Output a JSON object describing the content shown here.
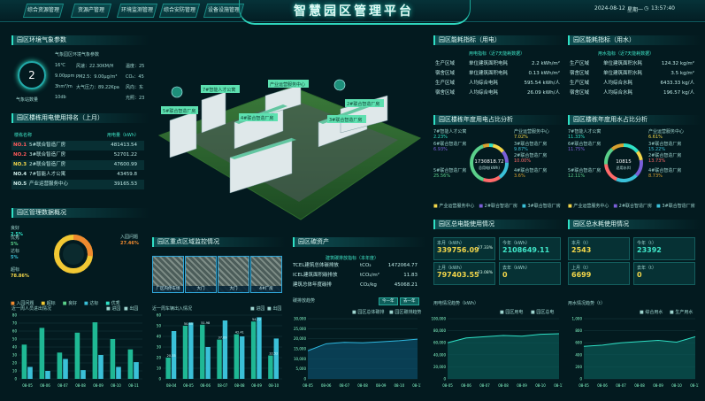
{
  "header": {
    "title": "智慧园区管理平台",
    "nav_left": [
      "综合资源管理",
      "资源产管理",
      "环境监测管理"
    ],
    "nav_right": [
      "综合安防管理",
      "设备设施管理"
    ],
    "date": "2024-08-12",
    "weekday": "星期一",
    "time": "13:57:40"
  },
  "env": {
    "title": "园区环境气象参数",
    "score": "2",
    "score_label": "气象站数量",
    "subtitle": "气象园区环境气象参数",
    "row1": [
      "16℃",
      "风速：22.30KM/H",
      "温度：25"
    ],
    "row2": [
      "9.00ppm",
      "PM2.5：9.00μg/m³",
      "CO₂：45"
    ],
    "row3": [
      "3hm³/m",
      "大气压力：89.22Kpa",
      "风向：东"
    ],
    "row4": [
      "10db",
      "",
      "光照：23"
    ]
  },
  "ranking": {
    "title": "园区楼栋用电使用排名（上月）",
    "col_name": "楼栋名称",
    "col_value": "用电量（kWh）",
    "rows": [
      {
        "no": "NO.1",
        "name": "5#联合智造厂房",
        "value": "481413.54"
      },
      {
        "no": "NO.2",
        "name": "3#联合智造厂房",
        "value": "52701.22"
      },
      {
        "no": "NO.3",
        "name": "2#联合智造厂房",
        "value": "47600.99"
      },
      {
        "no": "NO.4",
        "name": "7#智能人才公寓",
        "value": "43459.8"
      },
      {
        "no": "NO.5",
        "name": "产业运营服务中心",
        "value": "39165.53"
      }
    ]
  },
  "mgmt": {
    "title": "园区管理数据概况",
    "labels": [
      {
        "name": "良好",
        "pct": "2.5%"
      },
      {
        "name": "优秀",
        "pct": "5%"
      },
      {
        "name": "达标",
        "pct": "5%"
      },
      {
        "name": "超标",
        "pct": "78.86%"
      },
      {
        "name": "入园问题",
        "pct": "27.46%"
      }
    ],
    "legend": [
      "入园问题",
      "超标",
      "良好",
      "达标",
      "优秀"
    ],
    "chart_title": "近一周人员进出情况",
    "legend2": [
      "进园",
      "出园"
    ]
  },
  "people_chart": {
    "type": "bar",
    "categories": [
      "08-05",
      "08-06",
      "08-07",
      "08-08",
      "08-09",
      "08-10",
      "08-11"
    ],
    "series": [
      {
        "name": "进园",
        "values": [
          43,
          64,
          33,
          58,
          71,
          50,
          37
        ]
      },
      {
        "name": "出园",
        "values": [
          15,
          10,
          25,
          11,
          30,
          15,
          21
        ]
      }
    ],
    "ylim": [
      0,
      80
    ],
    "yticks": [
      "0",
      "10",
      "20",
      "30",
      "40",
      "50",
      "60",
      "70",
      "80"
    ]
  },
  "monitor": {
    "title": "园区重点区域监控情况",
    "cams": [
      "厂区内停车场",
      "大门",
      "大门",
      "4#厂房"
    ],
    "chart_title": "近一周车辆出入情况",
    "legend": [
      "进园",
      "出园"
    ]
  },
  "car_chart": {
    "type": "bar",
    "categories": [
      "08-04",
      "08-05",
      "08-06",
      "08-07",
      "08-08",
      "08-09",
      "08-10"
    ],
    "series": [
      {
        "name": "进园",
        "values": [
          20,
          50,
          51,
          37,
          42,
          54,
          22
        ]
      },
      {
        "name": "出园",
        "values": [
          45,
          53,
          30,
          55,
          40,
          58,
          38
        ]
      }
    ],
    "ylim": [
      0,
      60
    ],
    "yticks": [
      "0",
      "10",
      "20",
      "30",
      "40",
      "50",
      "60"
    ],
    "labels": [
      "20.33",
      "50.65",
      "51.98",
      "37.09",
      "42.41",
      "54.72",
      "22.52"
    ]
  },
  "carbon": {
    "title": "园区碳资产",
    "year_label": "建筑碳排放指标（本年度）",
    "rows": [
      {
        "name": "TCEL建筑总体碳排放",
        "unit": "tCO₂",
        "value": "1472064.77"
      },
      {
        "name": "ICEL建筑面积碳排放",
        "unit": "tCO₂/m²",
        "value": "11.83"
      },
      {
        "name": "建筑总体年度碳排",
        "unit": "CO₂/kg",
        "value": "45068.21"
      }
    ],
    "chart_title": "碳排放趋势",
    "tabs": [
      "今一年",
      "去一年"
    ],
    "legend": [
      "园区总体碳排",
      "园区碳排趋势"
    ]
  },
  "carbon_chart": {
    "type": "area",
    "ylim": [
      0,
      30000
    ],
    "yticks": [
      "0",
      "5,000",
      "10,000",
      "15,000",
      "20,000",
      "25,000",
      "30,000"
    ],
    "categories": [
      "08-05",
      "08-06",
      "08-07",
      "08-08",
      "08-09",
      "08-10",
      "08-11"
    ],
    "values": [
      14000,
      17500,
      18200,
      18000,
      18500,
      19000,
      19800
    ]
  },
  "elec": {
    "title": "园区能耗指标（用电）",
    "sub": "用电指标（近7天能耗数据）",
    "rows": [
      {
        "a": "生产区域",
        "b": "单位建筑面积电耗",
        "v": "2.2 kWh/m²"
      },
      {
        "a": "宿舍区域",
        "b": "单位建筑面积电耗",
        "v": "0.13 kWh/m²"
      },
      {
        "a": "生产区域",
        "b": "人均综合电耗",
        "v": "595.54 kWh/人"
      },
      {
        "a": "宿舍区域",
        "b": "人均综合电耗",
        "v": "26.09 kWh/人"
      }
    ]
  },
  "water": {
    "title": "园区能耗指标（用水）",
    "sub": "用水指标（近7天能耗数据）",
    "rows": [
      {
        "a": "生产区域",
        "b": "单位建筑面积水耗",
        "v": "124.32 kg/m²"
      },
      {
        "a": "宿舍区域",
        "b": "单位建筑面积水耗",
        "v": "3.5 kg/m²"
      },
      {
        "a": "生产区域",
        "b": "人均综合水耗",
        "v": "6433.33 kg/人"
      },
      {
        "a": "宿舍区域",
        "b": "人均综合水耗",
        "v": "196.57 kg/人"
      }
    ]
  },
  "elec_share": {
    "title": "园区楼栋年度用电占比分析",
    "center_value": "1730818.72",
    "center_unit": "总用电(kWh)",
    "labels": [
      {
        "name": "7#智能人才公寓",
        "pct": "2.23%"
      },
      {
        "name": "产业运营服务中心",
        "pct": "7.02%"
      },
      {
        "name": "6#联合智造厂房",
        "pct": "6.93%"
      },
      {
        "name": "3#联合智造厂房",
        "pct": "9.87%"
      },
      {
        "name": "2#联合智造厂房",
        "pct": "10.00%"
      },
      {
        "name": "5#联合智造厂房",
        "pct": "25.56%"
      },
      {
        "name": "4#联合智造厂房",
        "pct": "3.6%"
      }
    ],
    "legend": [
      "产业运营服务中心",
      "2#联合智造厂房",
      "3#联合智造厂房"
    ]
  },
  "water_share": {
    "title": "园区楼栋年度用水占比分析",
    "center_value": "10815",
    "center_unit": "总用水(t)",
    "labels": [
      {
        "name": "7#智能人才公寓",
        "pct": "11.33%"
      },
      {
        "name": "产业运营服务中心",
        "pct": "6.61%"
      },
      {
        "name": "6#联合智造厂房",
        "pct": "11.75%"
      },
      {
        "name": "3#联合智造厂房",
        "pct": "15.22%"
      },
      {
        "name": "2#联合智造厂房",
        "pct": "13.73%"
      },
      {
        "name": "5#联合智造厂房",
        "pct": "12.11%"
      },
      {
        "name": "4#联合智造厂房",
        "pct": "8.73%"
      }
    ],
    "legend": [
      "产业运营服务中心",
      "2#联合智造厂房",
      "3#联合智造厂房"
    ]
  },
  "elec_total": {
    "title": "园区总电能使用情况",
    "cells": [
      {
        "label": "本月（kWh）",
        "value": "339756.09",
        "pct": "27.33%"
      },
      {
        "label": "今年（kWh）",
        "value": "2108649.11",
        "pct": ""
      },
      {
        "label": "上月（kWh）",
        "value": "797403.55",
        "pct": "23.08%"
      },
      {
        "label": "去年（kWh）",
        "value": "0",
        "pct": ""
      }
    ],
    "chart_title": "用电情况趋势（kWh）",
    "legend": [
      "园区用电",
      "园区总电"
    ]
  },
  "elec_chart": {
    "type": "area",
    "ylim": [
      0,
      100000
    ],
    "yticks": [
      "0",
      "20,000",
      "40,000",
      "60,000",
      "80,000",
      "100,000"
    ],
    "categories": [
      "08-05",
      "08-06",
      "08-07",
      "08-08",
      "08-09",
      "08-10",
      "08-11"
    ],
    "values": [
      60000,
      68000,
      70000,
      72000,
      71000,
      74000,
      75000
    ]
  },
  "water_total": {
    "title": "园区总水耗使用情况",
    "cells": [
      {
        "label": "本月（t）",
        "value": "2543",
        "pct": ""
      },
      {
        "label": "今年（t）",
        "value": "23392",
        "pct": ""
      },
      {
        "label": "上月（t）",
        "value": "6699",
        "pct": ""
      },
      {
        "label": "去年（t）",
        "value": "0",
        "pct": ""
      }
    ],
    "chart_title": "用水情况趋势（t）",
    "legend": [
      "综合用水",
      "生产用水"
    ]
  },
  "water_chart": {
    "type": "area",
    "ylim": [
      0,
      1000
    ],
    "yticks": [
      "0",
      "200",
      "400",
      "600",
      "800",
      "1,000"
    ],
    "categories": [
      "08-05",
      "08-06",
      "08-07",
      "08-08",
      "08-09",
      "08-10",
      "08-11"
    ],
    "values": [
      540,
      560,
      600,
      620,
      640,
      610,
      700
    ]
  },
  "map_labels": [
    "5#联合智造厂房",
    "7#智能人才公寓",
    "4#联合智造厂房",
    "产业运营服务中心",
    "3#联合智造厂房",
    "2#联合智造厂房"
  ],
  "colors": {
    "accent": "#2fe0c5",
    "gold": "#f2d64a",
    "red": "#ff5555",
    "bar1": "#1fb894",
    "bar2": "#3ac0d8"
  }
}
